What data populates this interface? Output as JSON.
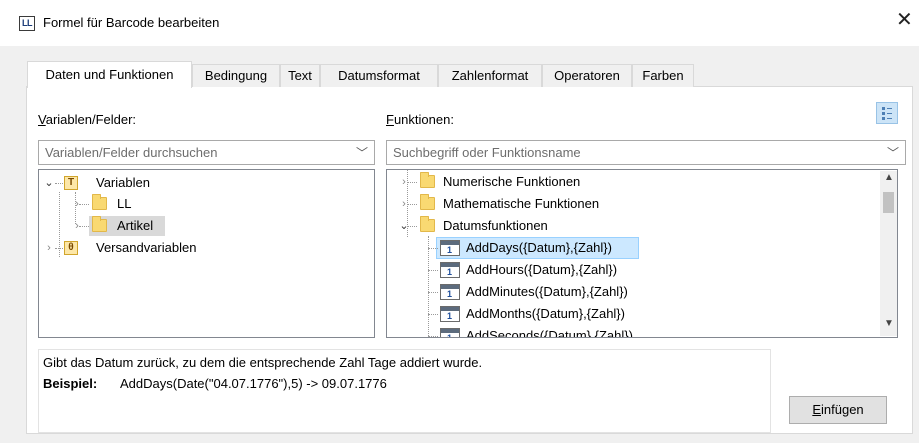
{
  "window": {
    "icon_text": "LL",
    "title": "Formel für Barcode bearbeiten"
  },
  "tabs": [
    {
      "label": "Daten und Funktionen",
      "active": true
    },
    {
      "label": "Bedingung",
      "active": false
    },
    {
      "label": "Text",
      "active": false
    },
    {
      "label": "Datumsformat",
      "active": false
    },
    {
      "label": "Zahlenformat",
      "active": false
    },
    {
      "label": "Operatoren",
      "active": false
    },
    {
      "label": "Farben",
      "active": false
    }
  ],
  "left": {
    "label_mnemonic": "V",
    "label_rest": "ariablen/Felder:",
    "search_placeholder": "Variablen/Felder durchsuchen",
    "tree": [
      {
        "label": "Variablen",
        "icon": "T",
        "state": "expanded"
      },
      {
        "label": "LL",
        "state": "collapsed"
      },
      {
        "label": "Artikel",
        "state": "collapsed",
        "selected": true
      },
      {
        "label": "Versandvariablen",
        "icon": "θ",
        "state": "collapsed"
      }
    ]
  },
  "right": {
    "label_mnemonic": "F",
    "label_rest": "unktionen:",
    "search_placeholder": "Suchbegriff oder Funktionsname",
    "tree": [
      {
        "label": "Numerische Funktionen",
        "state": "collapsed"
      },
      {
        "label": "Mathematische Funktionen",
        "state": "collapsed"
      },
      {
        "label": "Datumsfunktionen",
        "state": "expanded"
      },
      {
        "label": "AddDays({Datum},{Zahl})",
        "selected": true
      },
      {
        "label": "AddHours({Datum},{Zahl})"
      },
      {
        "label": "AddMinutes({Datum},{Zahl})"
      },
      {
        "label": "AddMonths({Datum},{Zahl})"
      },
      {
        "label": "AddSeconds({Datum},{Zahl})"
      }
    ],
    "fn_icon_glyph": "1"
  },
  "description": {
    "text": "Gibt das Datum zurück, zu dem die entsprechende Zahl Tage addiert wurde.",
    "example_label": "Beispiel:",
    "example_value": "AddDays(Date(\"04.07.1776\"),5) -> 09.07.1776"
  },
  "insert_button": {
    "mnemonic": "E",
    "rest": "infügen"
  },
  "icons": {
    "close": "close-icon",
    "expand": "chevron-right-icon",
    "collapse": "chevron-down-icon"
  },
  "colors": {
    "selection": "#cce8ff",
    "selection_border": "#99d1ff",
    "folder": "#f9d972",
    "panel_bg": "#f0f0f0"
  }
}
